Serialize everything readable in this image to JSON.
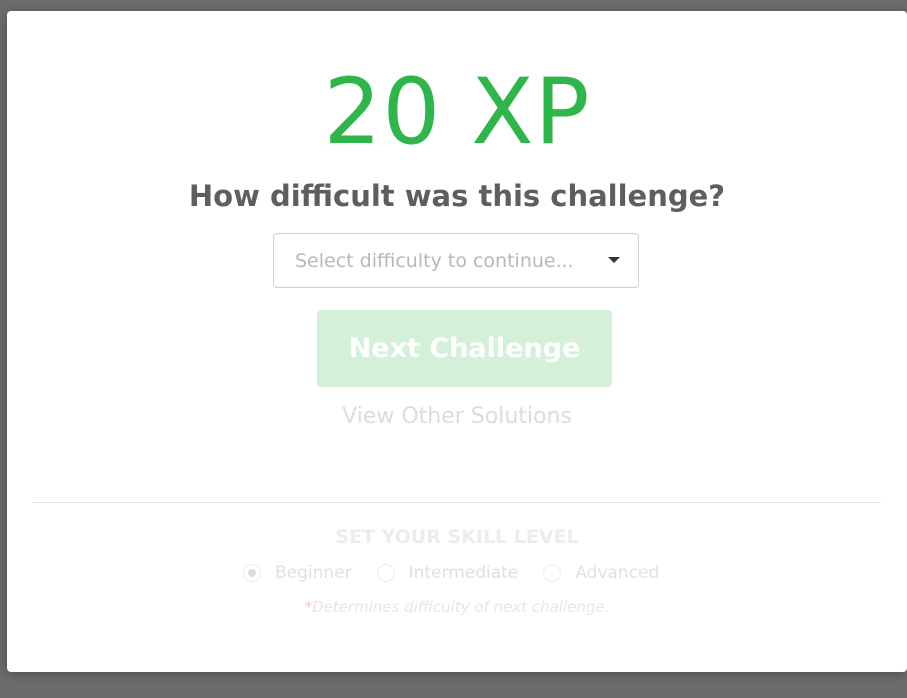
{
  "modal": {
    "xp": "20 XP",
    "question": "How difficult was this challenge?",
    "difficulty_select": {
      "placeholder": "Select difficulty to continue..."
    },
    "next_button": "Next Challenge",
    "view_solutions": "View Other Solutions",
    "skill_level": {
      "title": "SET YOUR SKILL LEVEL",
      "options": [
        {
          "label": "Beginner",
          "checked": true
        },
        {
          "label": "Intermediate",
          "checked": false
        },
        {
          "label": "Advanced",
          "checked": false
        }
      ],
      "note_star": "*",
      "note": "Determines difficulty of next challenge."
    }
  },
  "colors": {
    "xp_green": "#2fb64b",
    "button_disabled_green": "#d4f0d9",
    "overlay": "#6b6b6b"
  },
  "icons": {
    "select_caret": "caret-down-icon"
  }
}
